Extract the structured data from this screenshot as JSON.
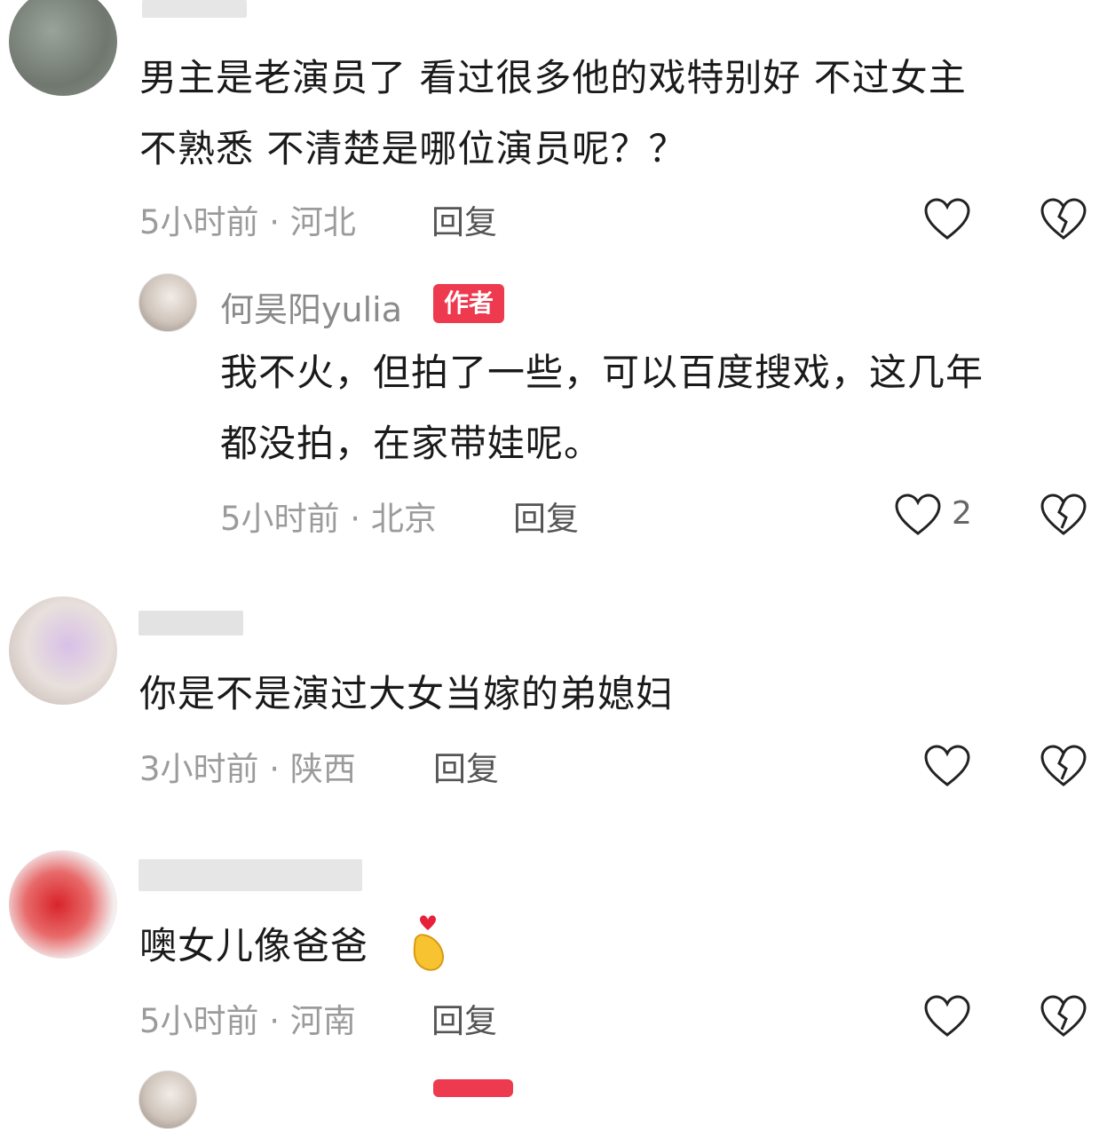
{
  "comments": [
    {
      "text_line1": "男主是老演员了  看过很多他的戏特别好  不过女主",
      "text_line2": "不熟悉 不清楚是哪位演员呢？？",
      "meta": "5小时前 · 河北",
      "reply_label": "回复"
    },
    {
      "author": "何昊阳yulia",
      "badge": "作者",
      "text_line1": "我不火，但拍了一些，可以百度搜戏，这几年",
      "text_line2": "都没拍，在家带娃呢。",
      "meta": "5小时前 · 北京",
      "reply_label": "回复",
      "like_count": "2"
    },
    {
      "text_line1": "你是不是演过大女当嫁的弟媳妇",
      "meta": "3小时前 · 陕西",
      "reply_label": "回复"
    },
    {
      "text_line1": "噢女儿像爸爸",
      "emoji": "heart-hands-emoji",
      "meta": "5小时前 · 河南",
      "reply_label": "回复"
    }
  ],
  "colors": {
    "badge": "#ee3a4f",
    "meta": "#9b9b9b",
    "text": "#1a1a1a"
  },
  "icons": {
    "like": "heart-outline-icon",
    "dislike": "broken-heart-icon"
  }
}
